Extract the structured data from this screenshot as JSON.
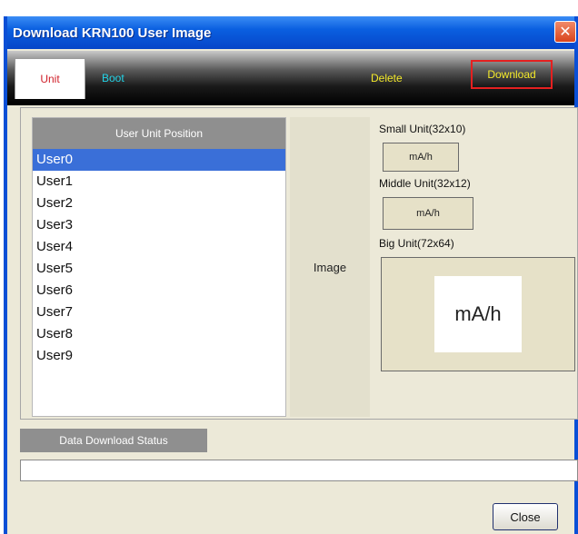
{
  "window": {
    "title": "Download KRN100 User Image",
    "close_symbol": "✕"
  },
  "tabs": {
    "unit": "Unit",
    "boot": "Boot",
    "delete": "Delete",
    "download": "Download"
  },
  "unit_list": {
    "header": "User Unit Position",
    "items": [
      "User0",
      "User1",
      "User2",
      "User3",
      "User4",
      "User5",
      "User6",
      "User7",
      "User8",
      "User9"
    ],
    "selected_index": 0
  },
  "image_panel": {
    "label": "Image",
    "small_label": "Small Unit(32x10)",
    "small_value": "mA/h",
    "middle_label": "Middle Unit(32x12)",
    "middle_value": "mA/h",
    "big_label": "Big Unit(72x64)",
    "big_value": "mA/h"
  },
  "status": {
    "label": "Data Download Status",
    "progress": 0
  },
  "buttons": {
    "close": "Close"
  },
  "colors": {
    "title_bar": "#0a5fe0",
    "selection": "#3a6fd8",
    "tab_unit_text": "#d0202a",
    "tab_boot_text": "#22d4e8",
    "tab_yellow_text": "#f4ea2a",
    "download_highlight": "#e52020"
  },
  "icons": {
    "close": "close-icon"
  }
}
